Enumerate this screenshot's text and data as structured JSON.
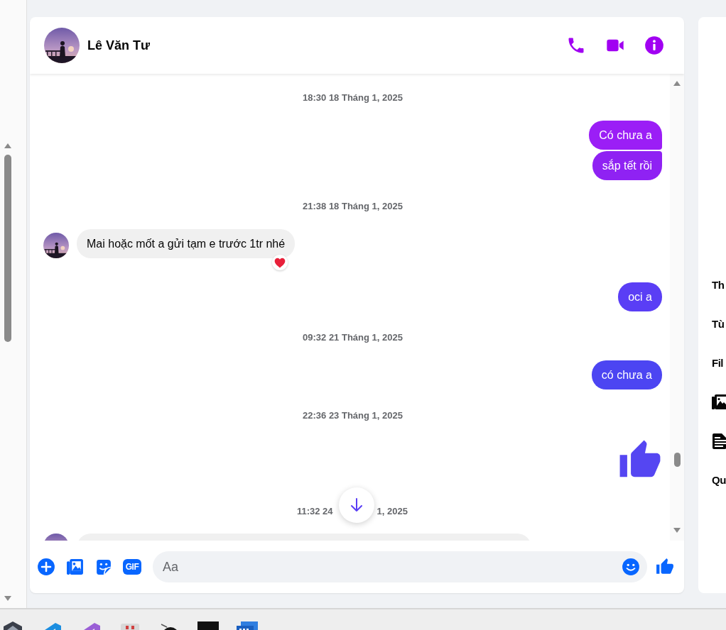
{
  "contact": {
    "name": "Lê Văn Tư"
  },
  "messages": [
    {
      "kind": "timestamp",
      "text": "18:30 18 Tháng 1, 2025"
    },
    {
      "kind": "sent",
      "text": "Có chưa a",
      "color": "#9b1ef6",
      "reacted": false
    },
    {
      "kind": "sent",
      "text": "sắp tết rồi",
      "color": "#8f22f3",
      "reacted": false
    },
    {
      "kind": "timestamp",
      "text": "21:38 18 Tháng 1, 2025"
    },
    {
      "kind": "received",
      "text": "Mai hoặc mốt a gửi tạm e trước 1tr nhé",
      "reacted": true
    },
    {
      "kind": "sent",
      "text": "oci a",
      "color": "#5a3ef5",
      "reacted": false
    },
    {
      "kind": "timestamp",
      "text": "09:32 21 Tháng 1, 2025"
    },
    {
      "kind": "sent",
      "text": "có chưa a",
      "color": "#4c45f2",
      "reacted": false
    },
    {
      "kind": "timestamp",
      "text": "22:36 23 Tháng 1, 2025"
    },
    {
      "kind": "like",
      "color": "#5546f2"
    },
    {
      "kind": "timestamp_covered",
      "parts": [
        "11:32 24",
        "1, 2025"
      ]
    },
    {
      "kind": "partial"
    }
  ],
  "composer": {
    "gif_label": "GIF",
    "placeholder": "Aa"
  },
  "side_panel": {
    "items": [
      {
        "kind": "text",
        "label": "Th"
      },
      {
        "kind": "text",
        "label": "Tù"
      },
      {
        "kind": "text",
        "label": "Fil"
      },
      {
        "kind": "media"
      },
      {
        "kind": "files"
      },
      {
        "kind": "text",
        "label": "Qu"
      }
    ]
  }
}
